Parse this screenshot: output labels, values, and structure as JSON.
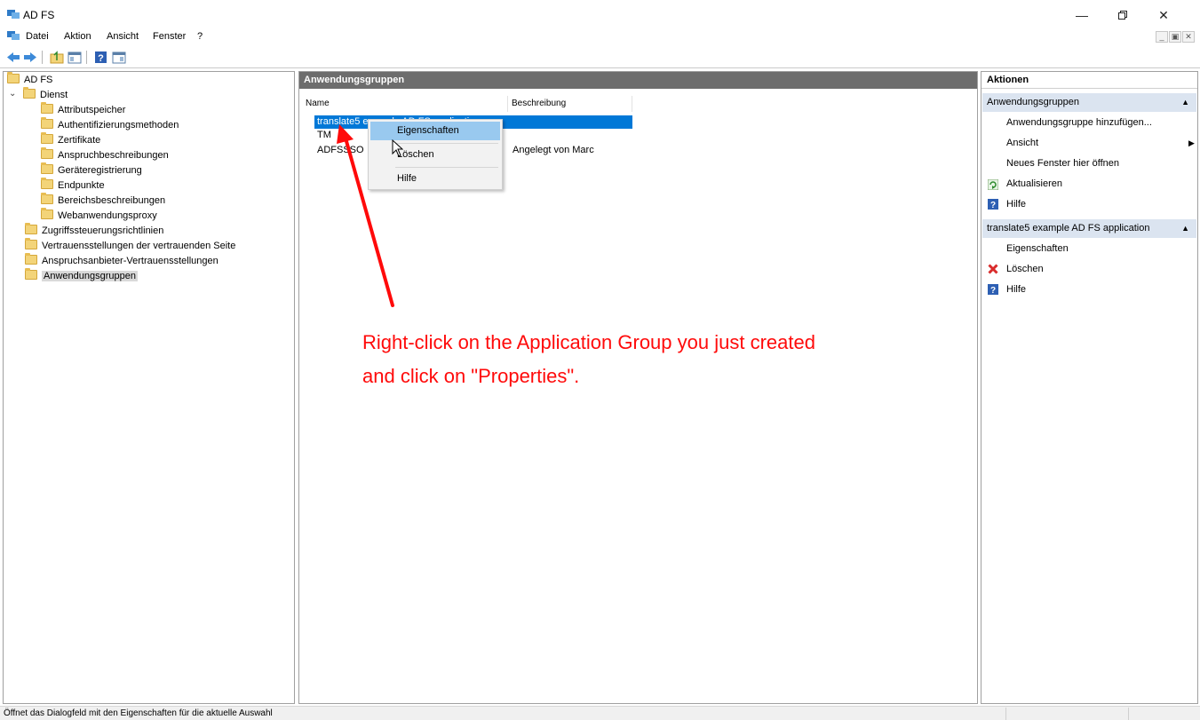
{
  "window": {
    "title": "AD FS"
  },
  "menu": [
    "Datei",
    "Aktion",
    "Ansicht",
    "Fenster",
    "?"
  ],
  "tree": {
    "root": "AD FS",
    "service": "Dienst",
    "service_children": [
      "Attributspeicher",
      "Authentifizierungsmethoden",
      "Zertifikate",
      "Anspruchbeschreibungen",
      "Geräteregistrierung",
      "Endpunkte",
      "Bereichsbeschreibungen",
      "Webanwendungsproxy"
    ],
    "top_level": [
      "Zugriffssteuerungsrichtlinien",
      "Vertrauensstellungen der vertrauenden Seite",
      "Anspruchsanbieter-Vertrauensstellungen",
      "Anwendungsgruppen"
    ]
  },
  "center": {
    "header": "Anwendungsgruppen",
    "columns": [
      "Name",
      "Beschreibung"
    ],
    "rows": [
      {
        "name": "translate5 example AD FS application",
        "description": ""
      },
      {
        "name": "TM",
        "description": ""
      },
      {
        "name": "ADFSSSO",
        "description": "Angelegt von Marc"
      }
    ]
  },
  "context_menu": [
    "Eigenschaften",
    "Löschen",
    "Hilfe"
  ],
  "actions": {
    "header": "Aktionen",
    "section1": {
      "title": "Anwendungsgruppen",
      "items": [
        "Anwendungsgruppe hinzufügen...",
        "Ansicht",
        "Neues Fenster hier öffnen",
        "Aktualisieren",
        "Hilfe"
      ]
    },
    "section2": {
      "title": "translate5 example AD FS application",
      "items": [
        "Eigenschaften",
        "Löschen",
        "Hilfe"
      ]
    }
  },
  "annotation": {
    "line1": "Right-click on the Application Group you just created",
    "line2": "and click on \"Properties\"."
  },
  "status": {
    "text": "Öffnet das Dialogfeld mit den Eigenschaften für die aktuelle Auswahl"
  },
  "colors": {
    "selection": "#0078d7",
    "annotation": "#ff0a0a",
    "header": "#6d6d6d",
    "section": "#dbe4f0"
  }
}
